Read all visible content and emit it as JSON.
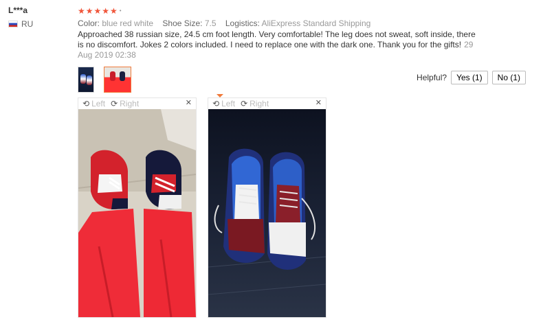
{
  "user": {
    "name": "L***a",
    "country": "RU"
  },
  "review": {
    "stars": "★★★★★",
    "attributes": [
      {
        "label": "Color:",
        "value": "blue red white"
      },
      {
        "label": "Shoe Size:",
        "value": "7.5"
      },
      {
        "label": "Logistics:",
        "value": "AliExpress Standard Shipping"
      }
    ],
    "text": "Approached 38 russian size, 24.5 cm foot length. Very comfortable! The leg does not sweat, soft inside, there is no discomfort. Jokes 2 colors included. I need to replace one with the dark one. Thank you for the gifts!",
    "date": "29 Aug 2019 02:38"
  },
  "helpful": {
    "label": "Helpful?",
    "yes": "Yes (1)",
    "no": "No (1)"
  },
  "viewer": {
    "left": "Left",
    "right": "Right",
    "close": "✕"
  }
}
